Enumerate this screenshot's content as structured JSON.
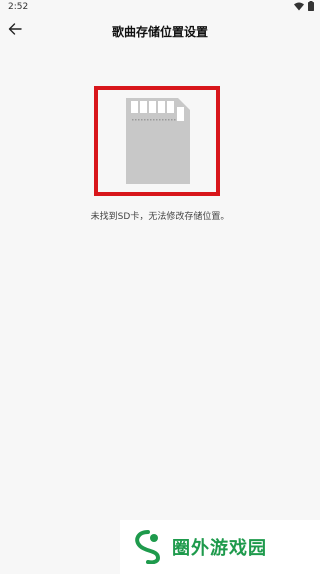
{
  "status_bar": {
    "time": "2:52"
  },
  "header": {
    "title": "歌曲存储位置设置",
    "back_icon": "arrow-left-icon"
  },
  "main": {
    "illustration": "sd-card-icon",
    "message": "未找到SD卡，无法修改存储位置。"
  },
  "watermark": {
    "text": "圈外游戏园"
  },
  "colors": {
    "highlight_border": "#d8161b",
    "sd_card": "#c8c8c8",
    "watermark_green": "#1e9a4c",
    "background": "#f7f7f7"
  }
}
